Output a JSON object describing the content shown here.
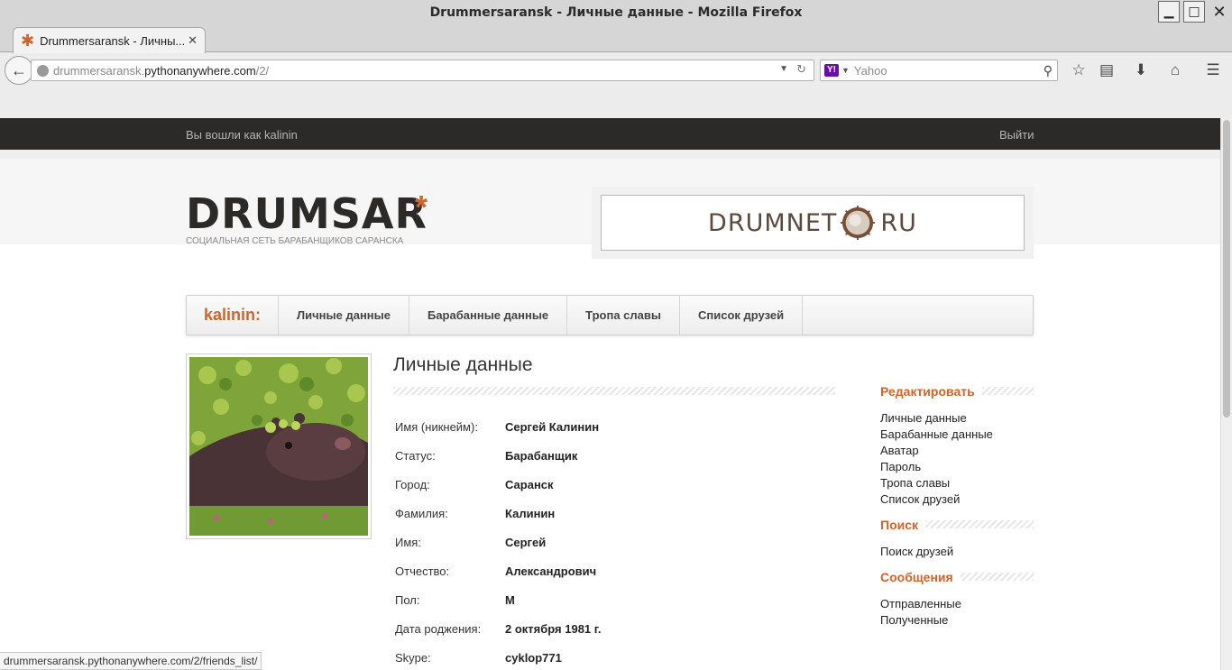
{
  "window": {
    "title": "Drummersaransk - Личные данные - Mozilla Firefox",
    "minimize_glyph": "▁",
    "maximize_glyph": "□",
    "close_glyph": "✕"
  },
  "tab": {
    "label": "Drummersaransk - Личны...",
    "close_glyph": "✕",
    "new_tab_glyph": "✚"
  },
  "nav": {
    "url_prefix": "drummersaransk.",
    "url_domain": "pythonanywhere.com",
    "url_path": "/2/",
    "search_placeholder": "Yahoo",
    "search_engine_glyph": "Y!",
    "icons": [
      "back-icon",
      "globe-icon",
      "reload-icon",
      "search-icon",
      "star-icon",
      "reading-list-icon",
      "download-icon",
      "home-icon",
      "menu-icon"
    ]
  },
  "site": {
    "logged_in_text": "Вы вошли как kalinin",
    "logout_label": "Выйти",
    "logo": "DRUMSAR",
    "logo_star": "*",
    "slogan": "СОЦИАЛЬНАЯ СЕТЬ БАРАБАНЩИКОВ САРАНСКА",
    "banner_left": "DRUMNET",
    "banner_right": "RU",
    "accent_color": "#d2632a"
  },
  "menu": {
    "user": "kalinin:",
    "items": [
      "Личные данные",
      "Барабанные данные",
      "Тропа славы",
      "Список друзей"
    ]
  },
  "profile": {
    "heading": "Личные данные",
    "fields": [
      {
        "label": "Имя (никнейм):",
        "value": "Сергей Калинин"
      },
      {
        "label": "Статус:",
        "value": "Барабанщик"
      },
      {
        "label": "Город:",
        "value": "Саранск"
      },
      {
        "label": "Фамилия:",
        "value": "Калинин"
      },
      {
        "label": "Имя:",
        "value": "Сергей"
      },
      {
        "label": "Отчество:",
        "value": "Александрович"
      },
      {
        "label": "Пол:",
        "value": "М"
      },
      {
        "label": "Дата роджения:",
        "value": "2 октября 1981 г."
      },
      {
        "label": "Skype:",
        "value": "cyklop771"
      }
    ]
  },
  "sidebar": {
    "edit_heading": "Редактировать",
    "edit_links": [
      "Личные данные",
      "Барабанные данные",
      "Аватар",
      "Пароль",
      "Тропа славы",
      "Список друзей"
    ],
    "search_heading": "Поиск",
    "search_links": [
      "Поиск друзей"
    ],
    "messages_heading": "Сообщения",
    "messages_links": [
      "Отправленные",
      "Полученные"
    ]
  },
  "status_bar": {
    "text": "drummersaransk.pythonanywhere.com/2/friends_list/"
  }
}
